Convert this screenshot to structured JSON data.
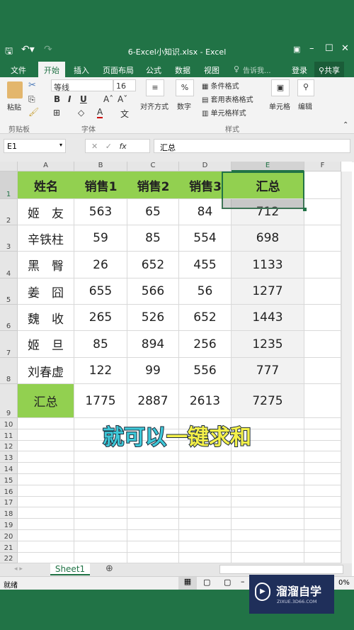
{
  "window": {
    "title": "6-Excel小知识.xlsx - Excel",
    "controls": [
      "restore-ribbon",
      "minimize",
      "maximize",
      "close"
    ]
  },
  "tabs": [
    {
      "label": "文件"
    },
    {
      "label": "开始",
      "active": true
    },
    {
      "label": "插入"
    },
    {
      "label": "页面布局"
    },
    {
      "label": "公式"
    },
    {
      "label": "数据"
    },
    {
      "label": "视图"
    }
  ],
  "tell_me": "告诉我...",
  "signin": "登录",
  "share": "共享",
  "ribbon": {
    "paste": "粘贴",
    "clipboard": "剪贴板",
    "font_name": "等线",
    "font_size": "16",
    "bold": "B",
    "italic": "I",
    "underline": "U",
    "font_group": "字体",
    "align": "对齐方式",
    "number": "数字",
    "percent": "%",
    "cond_format": "条件格式",
    "table_format": "套用表格格式",
    "cell_style": "单元格样式",
    "styles": "样式",
    "cells": "单元格",
    "edit": "编辑"
  },
  "formula_bar": {
    "name_box": "E1",
    "fx": "fx",
    "value": "汇总"
  },
  "columns": [
    "A",
    "B",
    "C",
    "D",
    "E",
    "F"
  ],
  "rows": [
    [
      "姓名",
      "销售1",
      "销售2",
      "销售3",
      "汇总"
    ],
    [
      "姬　友",
      "563",
      "65",
      "84",
      "712"
    ],
    [
      "辛铁柱",
      "59",
      "85",
      "554",
      "698"
    ],
    [
      "黑　臀",
      "26",
      "652",
      "455",
      "1133"
    ],
    [
      "姜　囧",
      "655",
      "566",
      "56",
      "1277"
    ],
    [
      "魏　收",
      "265",
      "526",
      "652",
      "1443"
    ],
    [
      "姬　旦",
      "85",
      "894",
      "256",
      "1235"
    ],
    [
      "刘春虚",
      "122",
      "99",
      "556",
      "777"
    ],
    [
      "汇总",
      "1775",
      "2887",
      "2613",
      "7275"
    ]
  ],
  "row_numbers": [
    "1",
    "2",
    "3",
    "4",
    "5",
    "6",
    "7",
    "8",
    "9",
    "10",
    "11",
    "12",
    "13",
    "14",
    "15",
    "16",
    "17",
    "18",
    "19",
    "20",
    "21",
    "22"
  ],
  "sheet_tab": "Sheet1",
  "status": "就绪",
  "zoom_tail": "0%",
  "overlay": {
    "part1": "就可以",
    "part2": "一键求和",
    "color1": "#3ec8d8",
    "color2": "#f4f04a"
  },
  "watermark": {
    "name": "溜溜自学",
    "url": "ZIXUE.3D66.COM"
  },
  "colors": {
    "excel_green": "#217346",
    "header_fill": "#92d050",
    "selection_border": "#217346"
  }
}
